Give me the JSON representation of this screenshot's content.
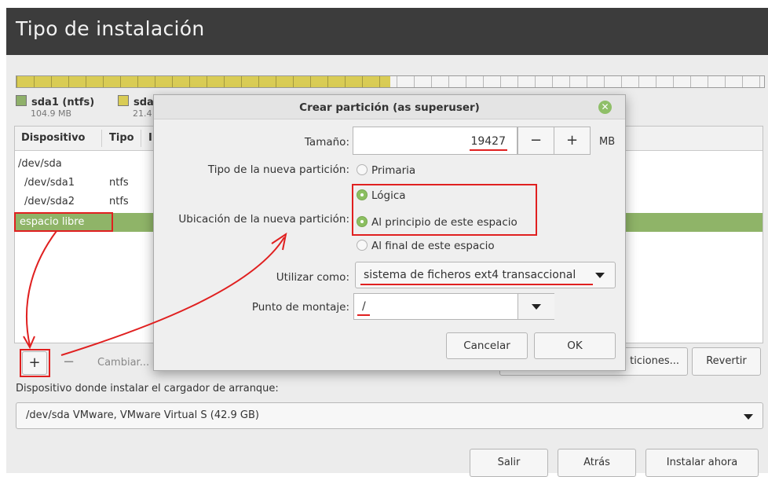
{
  "window": {
    "title": "Tipo de instalación"
  },
  "bar": {
    "used_fraction": 0.5
  },
  "legend": [
    {
      "name": "sda1 (ntfs)",
      "size": "104.9 MB",
      "color": "#8fb06a"
    },
    {
      "name": "sda",
      "size": "21.4",
      "color": "#d9cc55"
    }
  ],
  "table": {
    "headers": [
      "Dispositivo",
      "Tipo",
      "I"
    ],
    "rows": [
      {
        "device": "/dev/sda",
        "type": ""
      },
      {
        "device": "/dev/sda1",
        "type": "ntfs"
      },
      {
        "device": "/dev/sda2",
        "type": "ntfs"
      },
      {
        "device": "espacio libre",
        "type": ""
      }
    ]
  },
  "toolbar": {
    "add": "+",
    "remove": "−",
    "change": "Cambiar...",
    "new_table_fragment": "ticiones...",
    "revert": "Revertir"
  },
  "bootloader": {
    "label": "Dispositivo donde instalar el cargador de arranque:",
    "value": "/dev/sda   VMware, VMware Virtual S (42.9 GB)"
  },
  "footer": {
    "quit": "Salir",
    "back": "Atrás",
    "install": "Instalar ahora"
  },
  "dialog": {
    "title": "Crear partición (as superuser)",
    "size_label": "Tamaño:",
    "size_value": "19427",
    "size_unit": "MB",
    "minus": "−",
    "plus": "+",
    "type_label": "Tipo de la nueva partición:",
    "type_primary": "Primaria",
    "type_logical": "Lógica",
    "location_label": "Ubicación de la nueva partición:",
    "location_start": "Al principio de este espacio",
    "location_end": "Al final de este espacio",
    "use_as_label": "Utilizar como:",
    "use_as_value": "sistema de ficheros ext4 transaccional",
    "mount_label": "Punto de montaje:",
    "mount_value": "/",
    "cancel": "Cancelar",
    "ok": "OK"
  },
  "colors": {
    "accent": "#8fb468",
    "highlight": "#e02020",
    "title_bg": "#3c3c3c"
  }
}
